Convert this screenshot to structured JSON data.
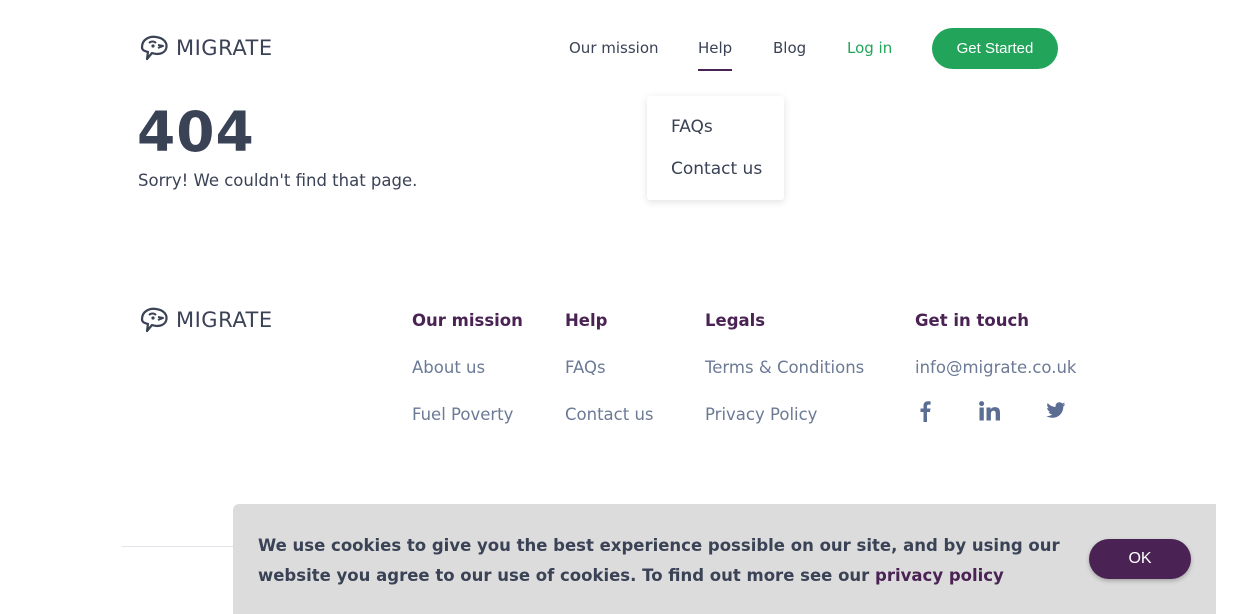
{
  "brand": {
    "name": "MIGRATE",
    "logo_icon": "speech-bubble-bird-icon"
  },
  "colors": {
    "primary_text": "#3a4255",
    "accent_green": "#22a55a",
    "accent_purple": "#4a2354",
    "link_muted": "#6c7a96",
    "banner_bg": "#dcdcdc"
  },
  "nav": {
    "items": [
      {
        "label": "Our mission"
      },
      {
        "label": "Help"
      },
      {
        "label": "Blog"
      },
      {
        "label": "Log in"
      }
    ],
    "cta_label": "Get Started",
    "active": "Help"
  },
  "help_dropdown": {
    "items": [
      {
        "label": "FAQs"
      },
      {
        "label": "Contact us"
      }
    ]
  },
  "error": {
    "code": "404",
    "message": "Sorry! We couldn't find that page."
  },
  "footer": {
    "columns": [
      {
        "heading": "Our mission",
        "links": [
          "About us",
          "Fuel Poverty"
        ]
      },
      {
        "heading": "Help",
        "links": [
          "FAQs",
          "Contact us"
        ]
      },
      {
        "heading": "Legals",
        "links": [
          "Terms & Conditions",
          "Privacy Policy"
        ]
      },
      {
        "heading": "Get in touch",
        "links": [
          "info@migrate.co.uk"
        ]
      }
    ],
    "social": [
      {
        "icon": "facebook-icon"
      },
      {
        "icon": "linkedin-icon"
      },
      {
        "icon": "twitter-icon"
      }
    ]
  },
  "cookie_banner": {
    "text": "We use cookies to give you the best experience possible on our site, and by using our website you agree to our use of cookies. To find out more see our",
    "link_text": "privacy policy",
    "ok_label": "OK"
  }
}
